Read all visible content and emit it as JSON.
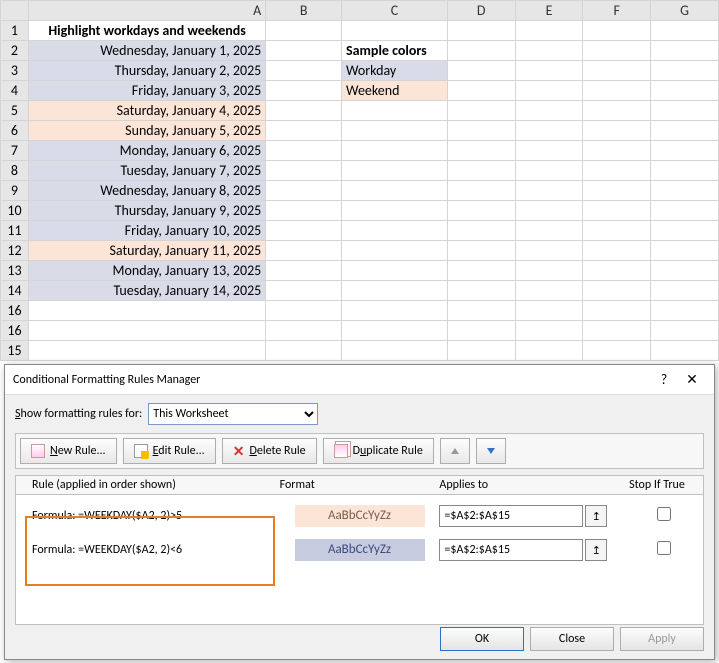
{
  "columns": [
    "A",
    "B",
    "C",
    "D",
    "E",
    "F",
    "G"
  ],
  "title_cell": "Highlight workdays and weekends",
  "sample_hdr": "Sample colors",
  "sample_workday": "Workday",
  "sample_weekend": "Weekend",
  "dates": [
    {
      "t": "Wednesday, January 1, 2025",
      "cls": "workday"
    },
    {
      "t": "Thursday, January 2, 2025",
      "cls": "workday"
    },
    {
      "t": "Friday, January 3, 2025",
      "cls": "workday"
    },
    {
      "t": "Saturday, January 4, 2025",
      "cls": "weekend"
    },
    {
      "t": "Sunday, January 5, 2025",
      "cls": "weekend"
    },
    {
      "t": "Monday, January 6, 2025",
      "cls": "workday"
    },
    {
      "t": "Tuesday, January 7, 2025",
      "cls": "workday"
    },
    {
      "t": "Wednesday, January 8, 2025",
      "cls": "workday"
    },
    {
      "t": "Thursday, January 9, 2025",
      "cls": "workday"
    },
    {
      "t": "Friday, January 10, 2025",
      "cls": "workday"
    },
    {
      "t": "Saturday, January 11, 2025",
      "cls": "weekend"
    },
    {
      "t": "Monday, January 13, 2025",
      "cls": "workday"
    },
    {
      "t": "Tuesday, January 14, 2025",
      "cls": "workday"
    }
  ],
  "rows_after": [
    "16",
    "16"
  ],
  "dialog": {
    "title": "Conditional Formatting Rules Manager",
    "show_label_pre": "S",
    "show_label": "how formatting rules for:",
    "show_sel": "This Worksheet",
    "btn_new": "New Rule...",
    "btn_edit": "Edit Rule...",
    "btn_del": "Delete Rule",
    "btn_dup": "Duplicate Rule",
    "hdr_rule": "Rule (applied in order shown)",
    "hdr_fmt": "Format",
    "hdr_app": "Applies to",
    "hdr_stop": "Stop If True",
    "rules": [
      {
        "label": "Formula: =WEEKDAY($A2, 2)>5",
        "fmt": "AaBbCcYyZz",
        "fmtcls": "fmt-wk",
        "range": "=$A$2:$A$15"
      },
      {
        "label": "Formula: =WEEKDAY($A2, 2)<6",
        "fmt": "AaBbCcYyZz",
        "fmtcls": "fmt-wd",
        "range": "=$A$2:$A$15"
      }
    ],
    "ok": "OK",
    "close": "Close",
    "apply": "Apply"
  }
}
